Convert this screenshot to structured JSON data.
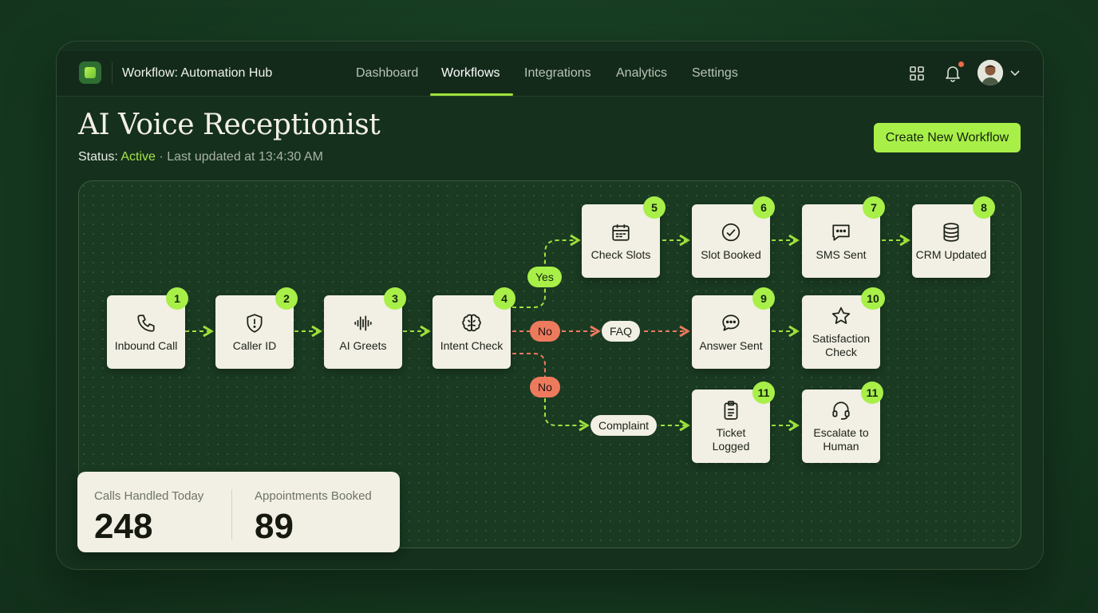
{
  "app": {
    "title": "Workflow: Automation Hub"
  },
  "nav": [
    {
      "label": "Dashboard",
      "active": false
    },
    {
      "label": "Workflows",
      "active": true
    },
    {
      "label": "Integrations",
      "active": false
    },
    {
      "label": "Analytics",
      "active": false
    },
    {
      "label": "Settings",
      "active": false
    }
  ],
  "header_icons": [
    "grid-icon",
    "bell-icon",
    "avatar",
    "chevron-down-icon"
  ],
  "page": {
    "title": "AI Voice Receptionist",
    "status_prefix": "Status:",
    "status_value": "Active",
    "separator": "·",
    "last_updated": "Last updated at 13:4:30 AM",
    "create_button": "Create New Workflow"
  },
  "workflow": {
    "nodes": [
      {
        "id": "inbound-call",
        "number": "1",
        "label": "Inbound Call",
        "icon": "phone-icon"
      },
      {
        "id": "caller-id",
        "number": "2",
        "label": "Caller ID",
        "icon": "shield-icon"
      },
      {
        "id": "ai-greets",
        "number": "3",
        "label": "AI Greets",
        "icon": "waveform-icon"
      },
      {
        "id": "intent-check",
        "number": "4",
        "label": "Intent Check",
        "icon": "brain-icon"
      },
      {
        "id": "check-slots",
        "number": "5",
        "label": "Check Slots",
        "icon": "calendar-icon"
      },
      {
        "id": "slot-booked",
        "number": "6",
        "label": "Slot Booked",
        "icon": "check-circle-icon"
      },
      {
        "id": "sms-sent",
        "number": "7",
        "label": "SMS Sent",
        "icon": "message-icon"
      },
      {
        "id": "crm-updated",
        "number": "8",
        "label": "CRM Updated",
        "icon": "database-icon"
      },
      {
        "id": "answer-sent",
        "number": "9",
        "label": "Answer Sent",
        "icon": "chat-bubble-icon"
      },
      {
        "id": "satisfaction-check",
        "number": "10",
        "label": "Satisfaction Check",
        "icon": "star-icon"
      },
      {
        "id": "ticket-logged",
        "number": "11",
        "label": "Ticket Logged",
        "icon": "clipboard-icon"
      },
      {
        "id": "escalate-to-human",
        "number": "11",
        "label": "Escalate to Human",
        "icon": "headset-icon"
      }
    ],
    "branches": {
      "yes": "Yes",
      "no_faq": "No",
      "faq": "FAQ",
      "no_complaint": "No",
      "complaint": "Complaint"
    },
    "colors": {
      "accent": "#a8ef48",
      "no_path": "#ee7a5e",
      "card": "#f2efe4"
    }
  },
  "stats": {
    "calls_label": "Calls Handled Today",
    "calls_value": "248",
    "appointments_label": "Appointments Booked",
    "appointments_value": "89"
  }
}
